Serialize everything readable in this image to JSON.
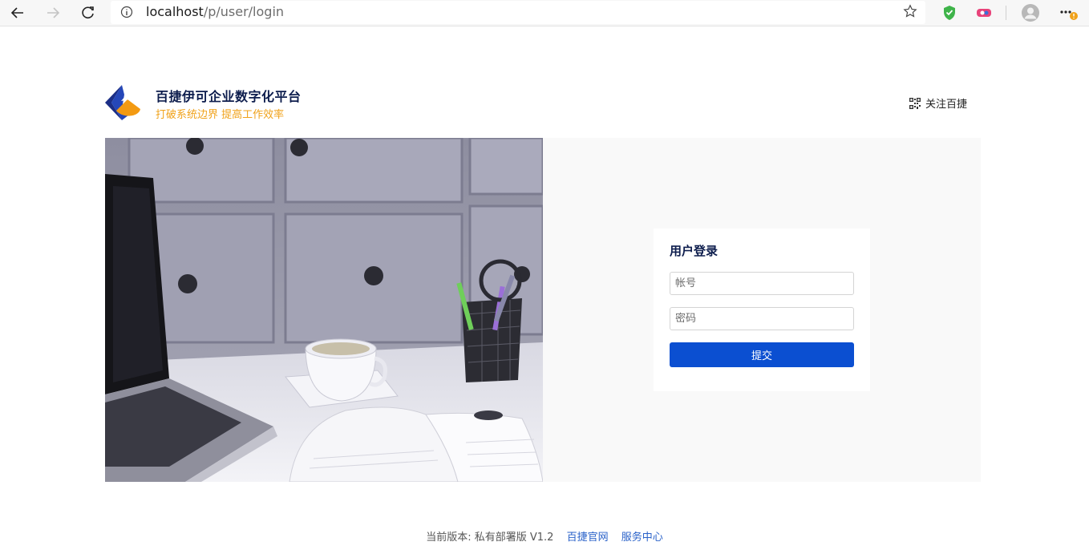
{
  "browser": {
    "url_host": "localhost",
    "url_path": "/p/user/login"
  },
  "header": {
    "title": "百捷伊可企业数字化平台",
    "subtitle": "打破系统边界 提高工作效率",
    "follow_label": "关注百捷"
  },
  "login": {
    "title": "用户登录",
    "account_placeholder": "帐号",
    "password_placeholder": "密码",
    "submit_label": "提交"
  },
  "footer": {
    "version_text": "当前版本: 私有部署版 V1.2",
    "link_official": "百捷官网",
    "link_service": "服务中心"
  },
  "colors": {
    "brand_navy": "#0d1d4d",
    "brand_orange": "#f0a21a",
    "primary_button": "#0b4fd1",
    "link": "#2a62c9"
  },
  "icons": [
    "back-arrow-icon",
    "forward-arrow-icon",
    "reload-icon",
    "info-icon",
    "star-icon",
    "shield-icon",
    "extension-icon",
    "profile-icon",
    "menu-dots-icon",
    "qrcode-icon"
  ]
}
